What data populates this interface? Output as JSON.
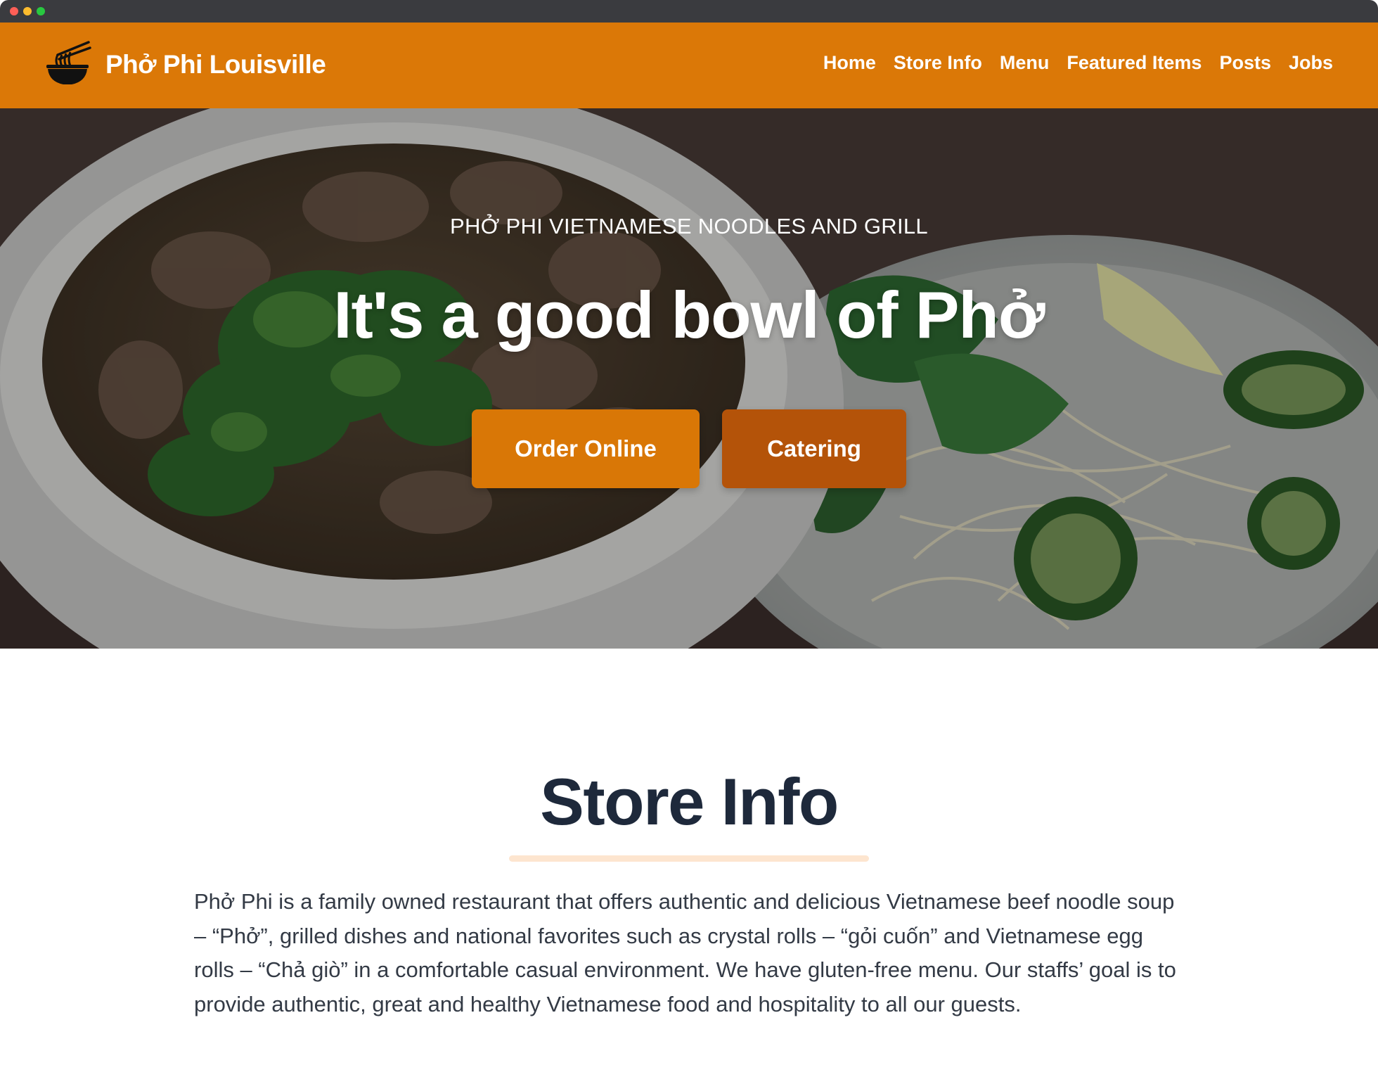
{
  "brand": {
    "name": "Phở Phi Louisville",
    "logo_icon": "noodle-bowl-icon",
    "color": "#db7807"
  },
  "nav": {
    "items": [
      {
        "label": "Home"
      },
      {
        "label": "Store Info"
      },
      {
        "label": "Menu"
      },
      {
        "label": "Featured Items"
      },
      {
        "label": "Posts"
      },
      {
        "label": "Jobs"
      }
    ]
  },
  "hero": {
    "eyebrow": "PHỞ PHI VIETNAMESE NOODLES AND GRILL",
    "title": "It's a good bowl of Phở",
    "buttons": {
      "order_label": "Order Online",
      "catering_label": "Catering"
    },
    "colors": {
      "order": "#d97706",
      "catering": "#b45309"
    }
  },
  "store_info": {
    "title": "Store Info",
    "description": "Phở Phi is a family owned restaurant that offers authentic and delicious Vietnamese beef noodle soup – “Phở”, grilled dishes and national favorites such as crystal rolls – “gỏi cuốn” and Vietnamese egg rolls – “Chả giò” in a comfortable casual environment. We have gluten-free menu. Our staffs’ goal is to provide authentic, great and healthy Vietnamese food and hospitality to all our guests."
  }
}
